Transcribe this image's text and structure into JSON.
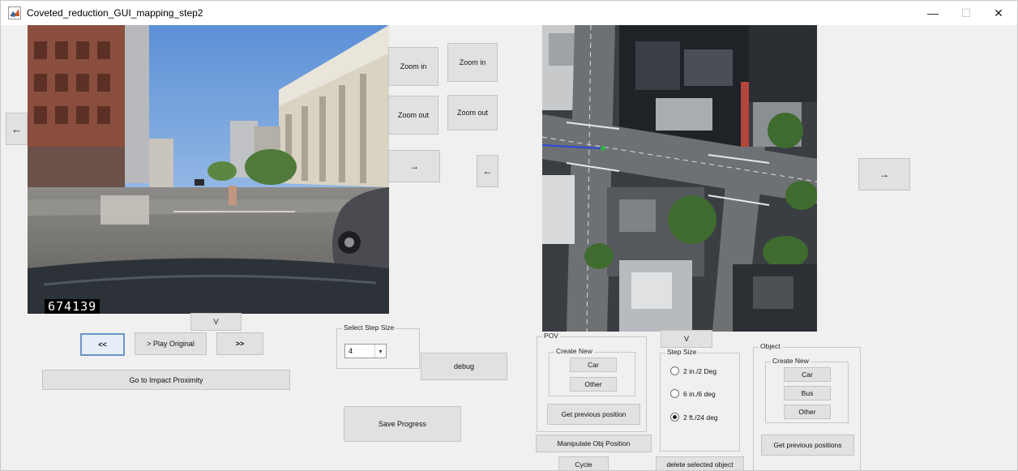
{
  "window": {
    "title": "Coveted_reduction_GUI_mapping_step2",
    "controls": {
      "minimize": "—",
      "maximize": "☐",
      "close": "✕"
    }
  },
  "video": {
    "frame_number": "674139"
  },
  "left_panel": {
    "prev_button": "←",
    "zoom_in_left": "Zoom in",
    "zoom_in_right": "Zoom in",
    "zoom_out_left": "Zoom out",
    "zoom_out_right": "Zoom out",
    "next_arrow": "→",
    "back_arrow": "←",
    "v_button": "V",
    "rewind_button": "<<",
    "play_button": "> Play Original",
    "forward_button": ">>",
    "impact_button": "Go to Impact Proximity"
  },
  "step_size_select": {
    "title": "Select Step Size",
    "value": "4"
  },
  "debug_button": "debug",
  "save_button": "Save Progress",
  "map_panel": {
    "right_arrow": "→",
    "v_button": "V"
  },
  "pov": {
    "title": "POV",
    "create_new_title": "Create New",
    "car_button": "Car",
    "other_button": "Other",
    "prev_position_button": "Get previous position",
    "manipulate_button": "Manipulate Obj Position",
    "cycle_button": "Cycle"
  },
  "step_size": {
    "title": "Step Size",
    "options": [
      {
        "label": "2 in./2 Deg",
        "selected": false
      },
      {
        "label": "6 in./6 deg",
        "selected": false
      },
      {
        "label": "2 ft./24 deg",
        "selected": true
      }
    ],
    "delete_button": "delete selected object"
  },
  "object": {
    "title": "Object",
    "create_new_title": "Create New",
    "car_button": "Car",
    "bus_button": "Bus",
    "other_button": "Other",
    "prev_positions_button": "Get previous positions"
  }
}
